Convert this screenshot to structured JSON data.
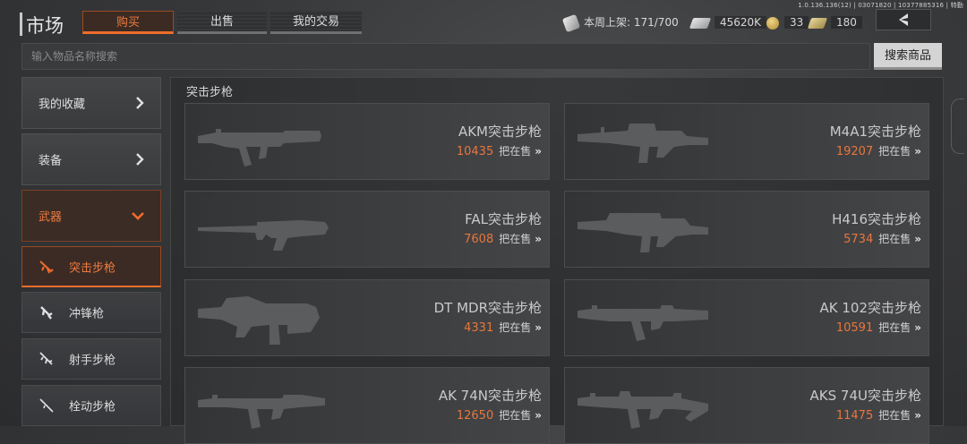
{
  "version": "1.0.136.136(12) | 03071820 | 10377885316 | 特勤",
  "header": {
    "title": "市场",
    "tabs": [
      {
        "label": "购买",
        "active": true
      },
      {
        "label": "出售",
        "active": false
      },
      {
        "label": "我的交易",
        "active": false
      }
    ],
    "weekly_listing_label": "本周上架: 171/700",
    "cash": "45620K",
    "coins": "33",
    "gold_cash": "180",
    "accent_color": "#ee6d2d"
  },
  "search": {
    "placeholder": "输入物品名称搜索",
    "button_label": "搜索商品"
  },
  "sidebar": {
    "items": [
      {
        "label": "我的收藏",
        "icon": "chevron-right-icon"
      },
      {
        "label": "装备",
        "icon": "chevron-right-icon"
      },
      {
        "label": "武器",
        "icon": "chevron-down-icon",
        "open": true
      }
    ],
    "subitems": [
      {
        "label": "突击步枪",
        "icon": "assault-rifle-icon",
        "active": true
      },
      {
        "label": "冲锋枪",
        "icon": "smg-icon",
        "active": false
      },
      {
        "label": "射手步枪",
        "icon": "marksman-rifle-icon",
        "active": false
      },
      {
        "label": "栓动步枪",
        "icon": "bolt-rifle-icon",
        "active": false
      }
    ]
  },
  "main": {
    "section_title": "突击步枪",
    "for_sale_label": "把在售",
    "items": [
      {
        "name": "AKM突击步枪",
        "price": "10435"
      },
      {
        "name": "M4A1突击步枪",
        "price": "19207"
      },
      {
        "name": "FAL突击步枪",
        "price": "7608"
      },
      {
        "name": "H416突击步枪",
        "price": "5734"
      },
      {
        "name": "DT MDR突击步枪",
        "price": "4331"
      },
      {
        "name": "AK 102突击步枪",
        "price": "10591"
      },
      {
        "name": "AK 74N突击步枪",
        "price": "12650"
      },
      {
        "name": "AKS 74U突击步枪",
        "price": "11475"
      }
    ]
  }
}
